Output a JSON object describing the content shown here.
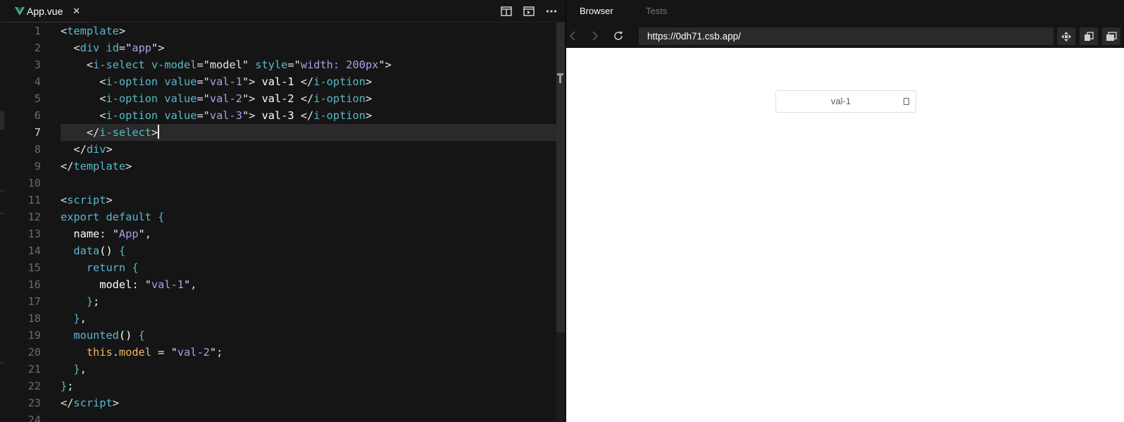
{
  "editor": {
    "tab": {
      "label": "App.vue",
      "close": "✕",
      "icon": "vue-logo-icon",
      "logo_color": "#41b883"
    },
    "actions": [
      "split-editor-icon",
      "open-preview-icon",
      "more-actions-icon"
    ],
    "active_line": 7,
    "lines": [
      {
        "n": "1",
        "tokens": [
          [
            "c-p",
            "<"
          ],
          [
            "c-t",
            "template"
          ],
          [
            "c-p",
            ">"
          ]
        ]
      },
      {
        "n": "2",
        "tokens": [
          [
            "c-p",
            "  <"
          ],
          [
            "c-t",
            "div"
          ],
          [
            "c-p",
            " "
          ],
          [
            "c-a",
            "id"
          ],
          [
            "c-p",
            "="
          ],
          [
            "c-p",
            "\""
          ],
          [
            "c-s",
            "app"
          ],
          [
            "c-p",
            "\""
          ],
          [
            "c-p",
            ">"
          ]
        ]
      },
      {
        "n": "3",
        "tokens": [
          [
            "c-p",
            "    <"
          ],
          [
            "c-t",
            "i-select"
          ],
          [
            "c-p",
            " "
          ],
          [
            "c-a",
            "v-model"
          ],
          [
            "c-p",
            "="
          ],
          [
            "c-p",
            "\"model\""
          ],
          [
            "c-p",
            " "
          ],
          [
            "c-a",
            "style"
          ],
          [
            "c-p",
            "="
          ],
          [
            "c-p",
            "\""
          ],
          [
            "c-s",
            "width: 200px"
          ],
          [
            "c-p",
            "\""
          ],
          [
            "c-p",
            ">"
          ]
        ]
      },
      {
        "n": "4",
        "tokens": [
          [
            "c-p",
            "      <"
          ],
          [
            "c-t",
            "i-option"
          ],
          [
            "c-p",
            " "
          ],
          [
            "c-a",
            "value"
          ],
          [
            "c-p",
            "="
          ],
          [
            "c-p",
            "\""
          ],
          [
            "c-s",
            "val-1"
          ],
          [
            "c-p",
            "\""
          ],
          [
            "c-p",
            ">"
          ],
          [
            "c-w",
            " val-1 "
          ],
          [
            "c-p",
            "</"
          ],
          [
            "c-t",
            "i-option"
          ],
          [
            "c-p",
            ">"
          ]
        ]
      },
      {
        "n": "5",
        "tokens": [
          [
            "c-p",
            "      <"
          ],
          [
            "c-t",
            "i-option"
          ],
          [
            "c-p",
            " "
          ],
          [
            "c-a",
            "value"
          ],
          [
            "c-p",
            "="
          ],
          [
            "c-p",
            "\""
          ],
          [
            "c-s",
            "val-2"
          ],
          [
            "c-p",
            "\""
          ],
          [
            "c-p",
            ">"
          ],
          [
            "c-w",
            " val-2 "
          ],
          [
            "c-p",
            "</"
          ],
          [
            "c-t",
            "i-option"
          ],
          [
            "c-p",
            ">"
          ]
        ]
      },
      {
        "n": "6",
        "tokens": [
          [
            "c-p",
            "      <"
          ],
          [
            "c-t",
            "i-option"
          ],
          [
            "c-p",
            " "
          ],
          [
            "c-a",
            "value"
          ],
          [
            "c-p",
            "="
          ],
          [
            "c-p",
            "\""
          ],
          [
            "c-s",
            "val-3"
          ],
          [
            "c-p",
            "\""
          ],
          [
            "c-p",
            ">"
          ],
          [
            "c-w",
            " val-3 "
          ],
          [
            "c-p",
            "</"
          ],
          [
            "c-t",
            "i-option"
          ],
          [
            "c-p",
            ">"
          ]
        ]
      },
      {
        "n": "7",
        "tokens": [
          [
            "c-p",
            "    </"
          ],
          [
            "c-t",
            "i-select"
          ],
          [
            "c-p",
            ">"
          ]
        ]
      },
      {
        "n": "8",
        "tokens": [
          [
            "c-p",
            "  </"
          ],
          [
            "c-t",
            "div"
          ],
          [
            "c-p",
            ">"
          ]
        ]
      },
      {
        "n": "9",
        "tokens": [
          [
            "c-p",
            "</"
          ],
          [
            "c-t",
            "template"
          ],
          [
            "c-p",
            ">"
          ]
        ]
      },
      {
        "n": "10",
        "tokens": []
      },
      {
        "n": "11",
        "tokens": [
          [
            "c-p",
            "<"
          ],
          [
            "c-t",
            "script"
          ],
          [
            "c-p",
            ">"
          ]
        ]
      },
      {
        "n": "12",
        "tokens": [
          [
            "c-k",
            "export"
          ],
          [
            "c-p",
            " "
          ],
          [
            "c-k",
            "default"
          ],
          [
            "c-p",
            " "
          ],
          [
            "c-k",
            "{"
          ]
        ]
      },
      {
        "n": "13",
        "tokens": [
          [
            "c-w",
            "  name"
          ],
          [
            "c-p",
            ": "
          ],
          [
            "c-p",
            "\""
          ],
          [
            "c-s",
            "App"
          ],
          [
            "c-p",
            "\""
          ],
          [
            "c-p",
            ","
          ]
        ]
      },
      {
        "n": "14",
        "tokens": [
          [
            "c-t",
            "  data"
          ],
          [
            "c-w",
            "()"
          ],
          [
            "c-p",
            " "
          ],
          [
            "c-k",
            "{"
          ]
        ]
      },
      {
        "n": "15",
        "tokens": [
          [
            "c-k",
            "    return"
          ],
          [
            "c-p",
            " "
          ],
          [
            "c-k",
            "{"
          ]
        ]
      },
      {
        "n": "16",
        "tokens": [
          [
            "c-w",
            "      model"
          ],
          [
            "c-p",
            ": "
          ],
          [
            "c-p",
            "\""
          ],
          [
            "c-s",
            "val-1"
          ],
          [
            "c-p",
            "\""
          ],
          [
            "c-p",
            ","
          ]
        ]
      },
      {
        "n": "17",
        "tokens": [
          [
            "c-k",
            "    }"
          ],
          [
            "c-p",
            ";"
          ]
        ]
      },
      {
        "n": "18",
        "tokens": [
          [
            "c-k",
            "  }"
          ],
          [
            "c-p",
            ","
          ]
        ]
      },
      {
        "n": "19",
        "tokens": [
          [
            "c-t",
            "  mounted"
          ],
          [
            "c-w",
            "()"
          ],
          [
            "c-p",
            " "
          ],
          [
            "c-k",
            "{"
          ]
        ]
      },
      {
        "n": "20",
        "tokens": [
          [
            "c-o",
            "    this"
          ],
          [
            "c-p",
            "."
          ],
          [
            "c-o",
            "model"
          ],
          [
            "c-p",
            " = "
          ],
          [
            "c-p",
            "\""
          ],
          [
            "c-s",
            "val-2"
          ],
          [
            "c-p",
            "\""
          ],
          [
            "c-p",
            ";"
          ]
        ]
      },
      {
        "n": "21",
        "tokens": [
          [
            "c-k",
            "  }"
          ],
          [
            "c-p",
            ","
          ]
        ]
      },
      {
        "n": "22",
        "tokens": [
          [
            "c-k",
            "}"
          ],
          [
            "c-p",
            ";"
          ]
        ]
      },
      {
        "n": "23",
        "tokens": [
          [
            "c-p",
            "</"
          ],
          [
            "c-t",
            "script"
          ],
          [
            "c-p",
            ">"
          ]
        ]
      },
      {
        "n": "24",
        "tokens": []
      }
    ]
  },
  "preview": {
    "tabs": {
      "browser": "Browser",
      "tests": "Tests"
    },
    "url": "https://0dh71.csb.app/",
    "nav_icons": [
      "back-arrow-icon",
      "forward-arrow-icon",
      "refresh-icon"
    ],
    "tool_icons": [
      "move-icon",
      "duplicate-window-icon",
      "new-window-icon"
    ],
    "select": {
      "value": "val-1"
    }
  }
}
